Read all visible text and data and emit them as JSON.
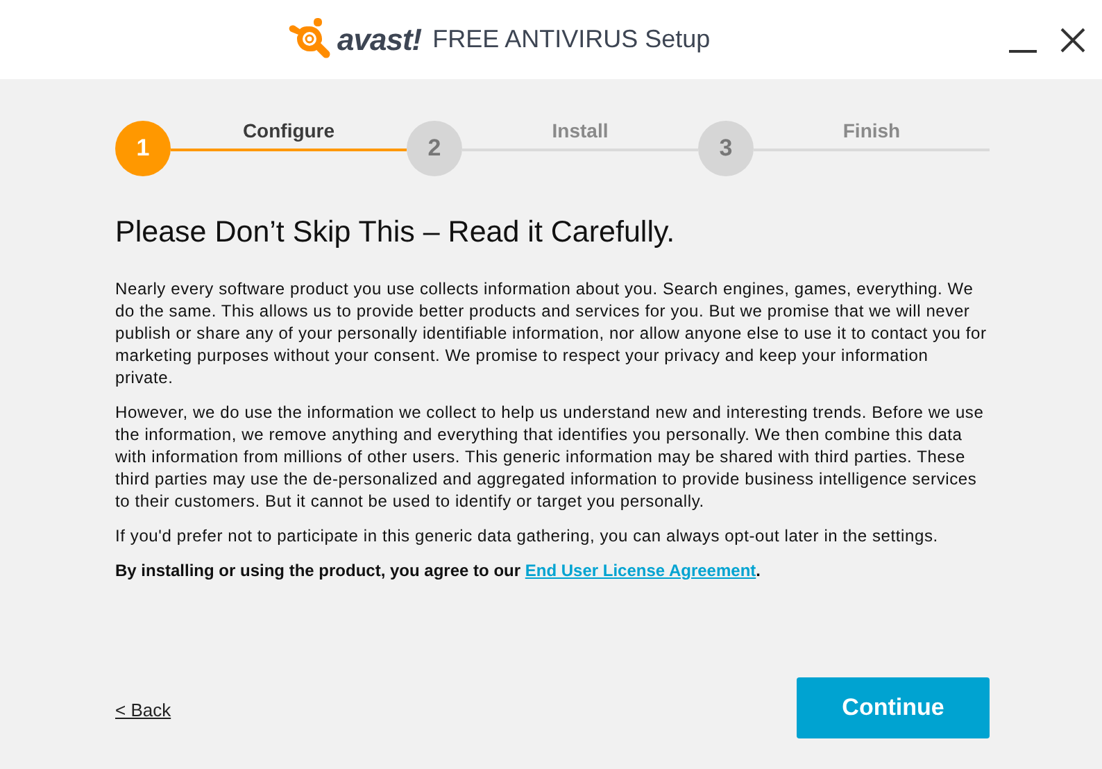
{
  "window": {
    "logo_text": "avast!",
    "title": "FREE ANTIVIRUS Setup"
  },
  "steps": [
    {
      "number": "1",
      "label": "Configure",
      "selected": true
    },
    {
      "number": "2",
      "label": "Install",
      "selected": false
    },
    {
      "number": "3",
      "label": "Finish",
      "selected": false
    }
  ],
  "heading": "Please Don’t Skip This – Read it Carefully.",
  "paragraphs": [
    "Nearly every software product you use collects information about you. Search engines, games, everything. We do the same. This allows us to provide better products and services for you. But we promise that we will never publish or share any of your personally identifiable information, nor allow anyone else to use it to contact you for marketing purposes without your consent. We promise to respect your privacy and keep your information private.",
    "However, we do use the information we collect to help us understand new and interesting trends. Before we use the information, we remove anything and everything that identifies you personally. We then combine this data with information from millions of other users. This generic information may be shared with third parties. These third parties may use the de-personalized and aggregated information to provide business intelligence services to their customers. But it cannot be used to identify or target you personally.",
    "If you'd prefer not to participate in this generic data gathering, you can always opt-out later in the settings."
  ],
  "agreement": {
    "text": "By installing or using the product, you agree to our",
    "link": "End User License Agreement",
    "end": "."
  },
  "back_link": "< Back",
  "continue_button": "Continue"
}
